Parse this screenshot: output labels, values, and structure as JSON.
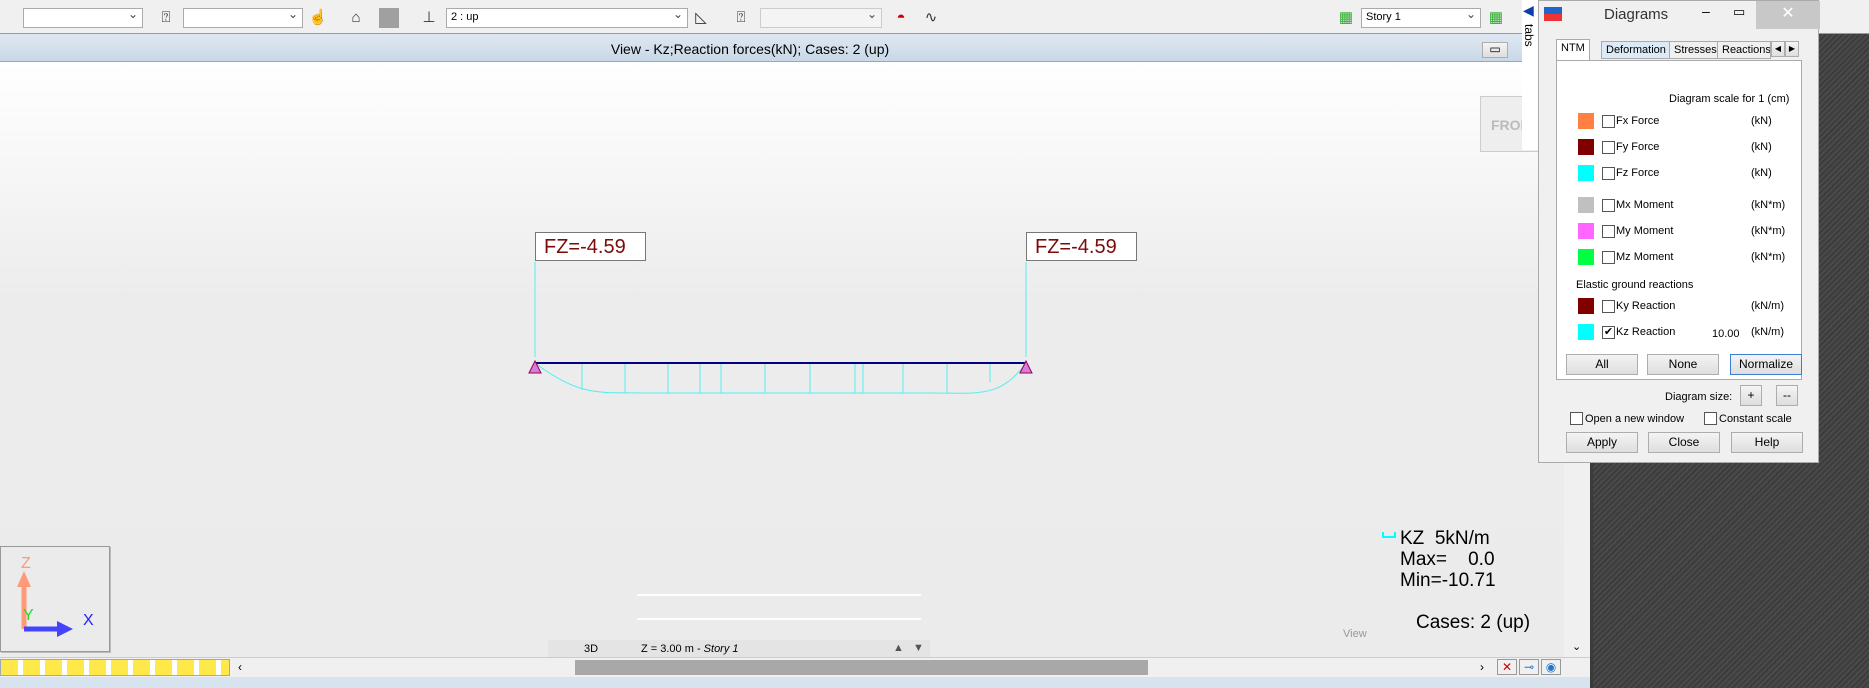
{
  "toolbar": {
    "combo1": "",
    "combo2": "",
    "load_case": "2 : up",
    "combo4": "",
    "story": "Story 1"
  },
  "view": {
    "title": "View - Kz;Reaction forces(kN); Cases: 2 (up)",
    "front_label": "FRONT",
    "labels": [
      "FZ=-4.59",
      "FZ=-4.59"
    ],
    "legend": {
      "name": "KZ  5kN/m",
      "max": "Max=    0.0",
      "min": "Min=-10.71"
    },
    "cases": "Cases: 2 (up)",
    "axis": {
      "z": "Z",
      "y": "Y",
      "x": "X"
    },
    "status": {
      "mode": "3D",
      "level": "Z = 3.00 m - ",
      "story": "Story 1"
    },
    "view_label": "View"
  },
  "side_tab": "tabs",
  "dialog": {
    "title": "Diagrams",
    "tabs": [
      "NTM",
      "Deformation",
      "Stresses",
      "Reactions"
    ],
    "scale_header": "Diagram scale for 1  (cm)",
    "items": [
      {
        "label": "Fx Force",
        "unit": "(kN)",
        "color": "#ff8040",
        "checked": false,
        "value": ""
      },
      {
        "label": "Fy Force",
        "unit": "(kN)",
        "color": "#800000",
        "checked": false,
        "value": ""
      },
      {
        "label": "Fz Force",
        "unit": "(kN)",
        "color": "#00ffff",
        "checked": false,
        "value": ""
      },
      {
        "label": "Mx Moment",
        "unit": "(kN*m)",
        "color": "#c0c0c0",
        "checked": false,
        "value": ""
      },
      {
        "label": "My Moment",
        "unit": "(kN*m)",
        "color": "#ff66ff",
        "checked": false,
        "value": ""
      },
      {
        "label": "Mz Moment",
        "unit": "(kN*m)",
        "color": "#00ff40",
        "checked": false,
        "value": ""
      }
    ],
    "elastic_header": "Elastic ground reactions",
    "elastic": [
      {
        "label": "Ky Reaction",
        "unit": "(kN/m)",
        "color": "#800000",
        "checked": false,
        "value": ""
      },
      {
        "label": "Kz Reaction",
        "unit": "(kN/m)",
        "color": "#00ffff",
        "checked": true,
        "value": "10.00"
      }
    ],
    "buttons": {
      "all": "All",
      "none": "None",
      "normalize": "Normalize",
      "plus": "+",
      "minus": "--",
      "apply": "Apply",
      "close": "Close",
      "help": "Help"
    },
    "diagram_size": "Diagram size:",
    "open_new_window": "Open a new window",
    "constant_scale": "Constant scale"
  }
}
